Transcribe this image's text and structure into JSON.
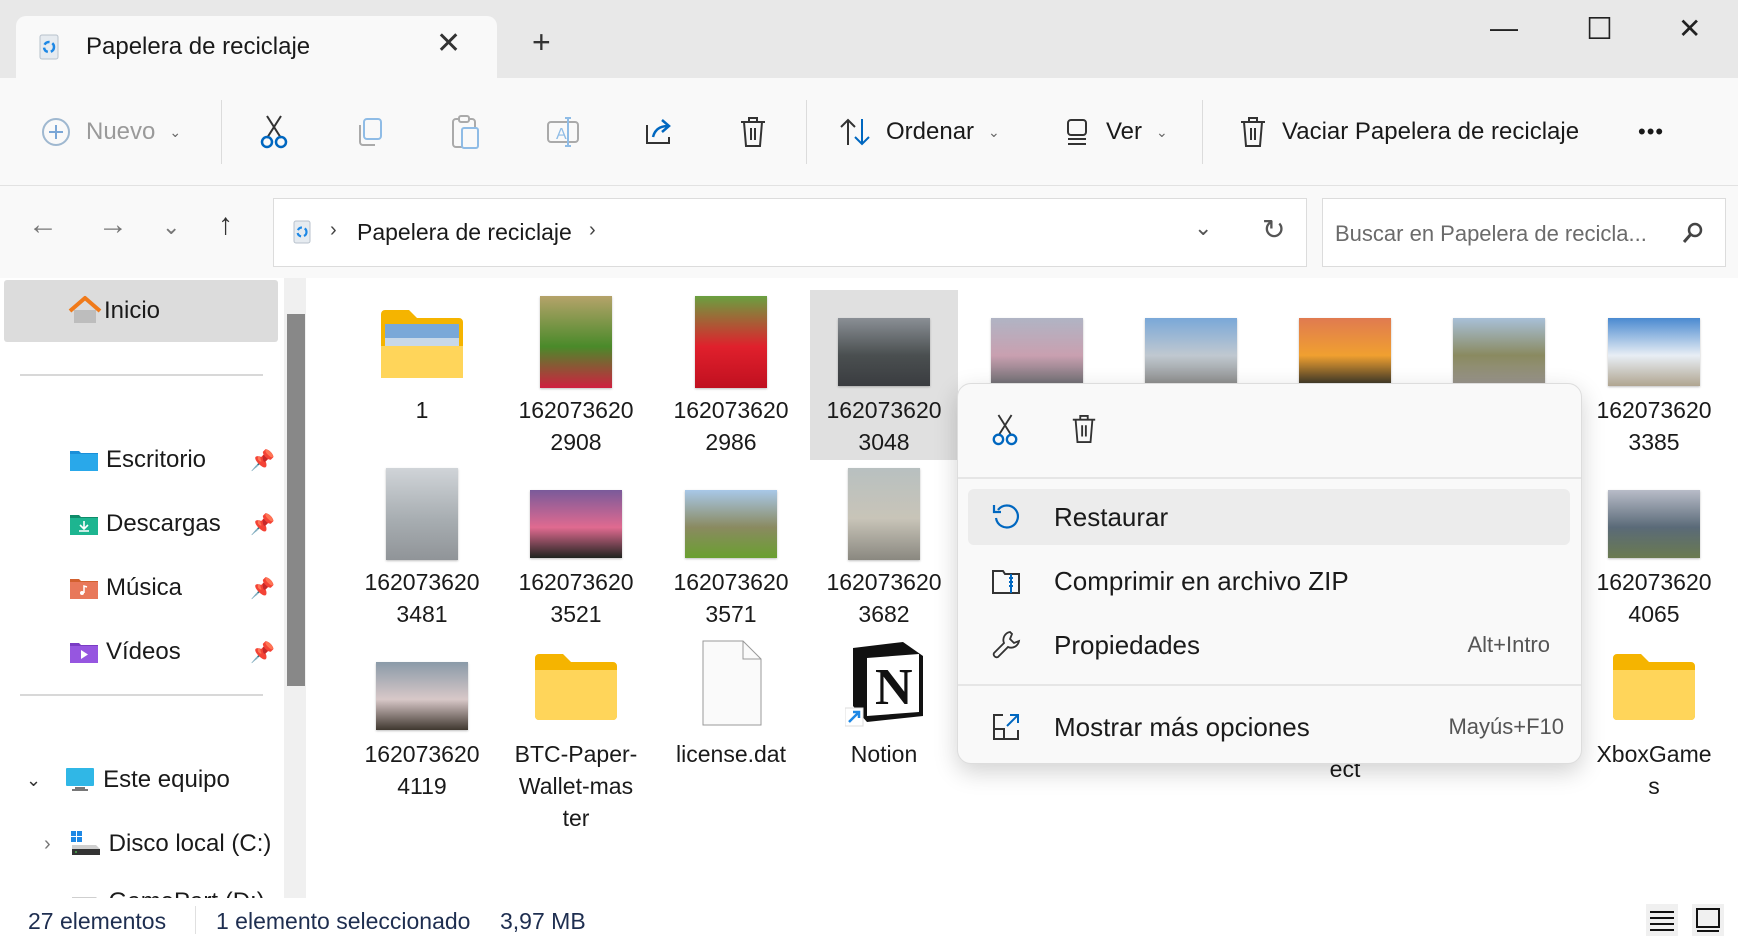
{
  "window": {
    "tab_title": "Papelera de reciclaje",
    "new_tab_label": "+",
    "minimize_label": "—",
    "maximize_label": "☐",
    "close_label": "✕"
  },
  "toolbar": {
    "new_label": "Nuevo",
    "sort_label": "Ordenar",
    "view_label": "Ver",
    "empty_bin_label": "Vaciar Papelera de reciclaje",
    "more_label": "•••"
  },
  "address": {
    "breadcrumb": [
      "Papelera de reciclaje"
    ],
    "search_placeholder": "Buscar en Papelera de recicla..."
  },
  "sidebar": {
    "home": "Inicio",
    "quick_access": [
      {
        "label": "Escritorio",
        "icon": "desktop-folder-icon",
        "pinned": true
      },
      {
        "label": "Descargas",
        "icon": "downloads-folder-icon",
        "pinned": true
      },
      {
        "label": "Música",
        "icon": "music-folder-icon",
        "pinned": true
      },
      {
        "label": "Vídeos",
        "icon": "videos-folder-icon",
        "pinned": true
      }
    ],
    "this_pc": "Este equipo",
    "drives": [
      {
        "label": "Disco local (C:)"
      },
      {
        "label": "GamePart (D:)"
      }
    ]
  },
  "files": [
    {
      "line1": "1",
      "line2": "",
      "type": "folder-image"
    },
    {
      "line1": "162073620",
      "line2": "2908",
      "type": "photo-tulips"
    },
    {
      "line1": "162073620",
      "line2": "2986",
      "type": "photo-redtulip"
    },
    {
      "line1": "162073620",
      "line2": "3048",
      "type": "photo-cloudy",
      "selected": true
    },
    {
      "line1": "",
      "line2": "",
      "type": "photo-road"
    },
    {
      "line1": "",
      "line2": "",
      "type": "photo-duck"
    },
    {
      "line1": "",
      "line2": "",
      "type": "photo-sunset"
    },
    {
      "line1": "",
      "line2": "",
      "type": "photo-duck2"
    },
    {
      "line1": "162073620",
      "line2": "3385",
      "type": "photo-beach"
    },
    {
      "line1": "162073620",
      "line2": "3481",
      "type": "photo-water-bird"
    },
    {
      "line1": "162073620",
      "line2": "3521",
      "type": "photo-pink-sunset"
    },
    {
      "line1": "162073620",
      "line2": "3571",
      "type": "photo-field"
    },
    {
      "line1": "162073620",
      "line2": "3682",
      "type": "photo-duck-ground"
    },
    {
      "line1": "162073620",
      "line2": "4065",
      "type": "photo-lake"
    },
    {
      "line1": "162073620",
      "line2": "4119",
      "type": "photo-blossom"
    },
    {
      "line1": "BTC-Paper-",
      "line2": "Wallet-mas",
      "line3": "ter",
      "type": "folder"
    },
    {
      "line1": "license.dat",
      "line2": "",
      "type": "file"
    },
    {
      "line1": "Notion",
      "line2": "",
      "type": "shortcut-notion"
    },
    {
      "line1": "ect",
      "line2": "",
      "type": "hidden"
    },
    {
      "line1": "XboxGame",
      "line2": "s",
      "type": "folder"
    }
  ],
  "context_menu": {
    "items": [
      {
        "label": "Restaurar",
        "shortcut": ""
      },
      {
        "label": "Comprimir en archivo ZIP",
        "shortcut": ""
      },
      {
        "label": "Propiedades",
        "shortcut": "Alt+Intro"
      },
      {
        "label": "Mostrar más opciones",
        "shortcut": "Mayús+F10"
      }
    ]
  },
  "status": {
    "count": "27 elementos",
    "selection": "1 elemento seleccionado",
    "size": "3,97 MB"
  },
  "colors": {
    "accent": "#0067c0",
    "selection": "#e0e0e0"
  }
}
